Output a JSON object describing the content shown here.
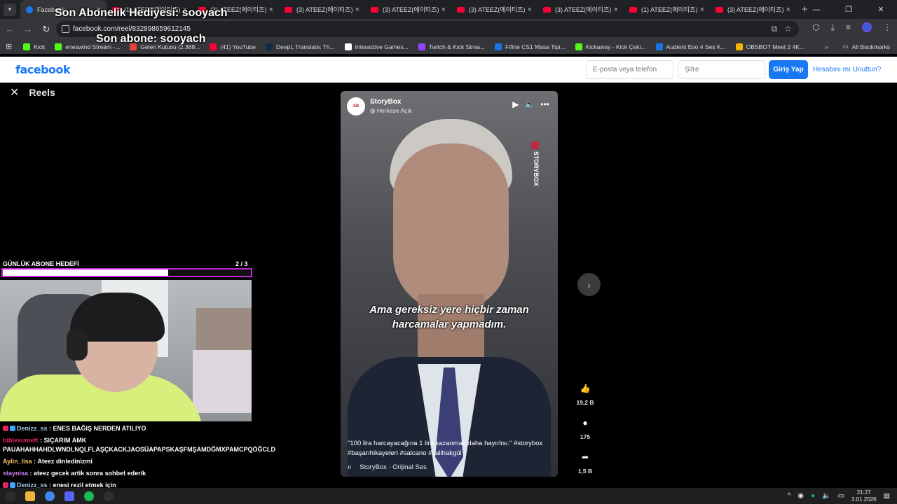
{
  "browser": {
    "tabs": [
      {
        "title": "Facebook",
        "active": true,
        "favicon": "facebook-icon"
      },
      {
        "title": "(1) ATEEZ(에이티즈)",
        "favicon": "youtube-icon"
      },
      {
        "title": "(3) ATEEZ(에이티즈)",
        "favicon": "youtube-icon"
      },
      {
        "title": "(3) ATEEZ(에이티즈)",
        "favicon": "youtube-icon"
      },
      {
        "title": "(3) ATEEZ(에이티즈)",
        "favicon": "youtube-icon"
      },
      {
        "title": "(3) ATEEZ(에이티즈)",
        "favicon": "youtube-icon"
      },
      {
        "title": "(3) ATEEZ(에이티즈)",
        "favicon": "youtube-icon"
      },
      {
        "title": "(1) ATEEZ(에이티즈)",
        "favicon": "youtube-icon"
      },
      {
        "title": "(3) ATEEZ(에이티즈)",
        "favicon": "youtube-icon"
      }
    ],
    "url": "facebook.com/reel/832898659612145",
    "bookmarks": [
      {
        "label": "Kick",
        "color": "#53fc18"
      },
      {
        "label": "eneswind Stream -...",
        "color": "#53fc18"
      },
      {
        "label": "Gelen Kutusu (2.368...",
        "color": "#ea4335"
      },
      {
        "label": "(41) YouTube",
        "color": "#ff0033"
      },
      {
        "label": "DeepL Translate: Th...",
        "color": "#0f2b46"
      },
      {
        "label": "Interactive Games...",
        "color": "#ffffff"
      },
      {
        "label": "Twitch & Kick Strea...",
        "color": "#9146ff"
      },
      {
        "label": "Fifine CS1 Masa Tipi...",
        "color": "#1a73e8"
      },
      {
        "label": "Kickaway - Kick Çeki...",
        "color": "#53fc18"
      },
      {
        "label": "Audient Evo 4 Ses K...",
        "color": "#1a73e8"
      },
      {
        "label": "OBSBOT Meet 2 4K...",
        "color": "#f4b400"
      }
    ],
    "all_bookmarks": "All Bookmarks"
  },
  "facebook": {
    "logo": "facebook",
    "email_placeholder": "E-posta veya telefon",
    "password_placeholder": "Şifre",
    "login_label": "Giriş Yap",
    "forgot_label": "Hesabını mı Unuttun?"
  },
  "reels": {
    "title": "Reels",
    "video": {
      "channel": "StoryBox",
      "privacy": "Herkese Açık",
      "brand_text": "STORYBOX",
      "subtitle": "Ama gereksiz yere hiçbir zaman harcamalar yapmadım.",
      "caption": "\"100 lira harcayacağına 1 lira kazanmak daha hayırlısı.\" #storybox #başarıhikayeleri #salcano  #salihakgül",
      "audio": "StoryBox · Orijinal Ses"
    },
    "actions": {
      "likes": "19,2 B",
      "comments": "175",
      "shares": "1,5 B"
    }
  },
  "stream_overlay": {
    "last_sub_gift": "Son Abonelik Hediyesi: sooyach",
    "last_sub": "Son abone: sooyach",
    "goal_label": "GÜNLÜK ABONE HEDEFİ",
    "goal_count": "2  / 3",
    "goal_progress": 0.667,
    "accent": "#c026d3",
    "chat": [
      {
        "user": "Denizz_ss",
        "user_color": "#a7c7e7",
        "text": ": ENES BAĞIŞ NERDEN ATILIYO"
      },
      {
        "user": "biblesumett",
        "user_color": "#e0245e",
        "text": ": SIÇARIM AMK PAUAHAHHAHDLWNDLNQLFLAŞÇKACKJAOSÜAPAPSKAŞFMŞAMDĞMXPAMCPQÖĞCLD"
      },
      {
        "user": "Aylin_lisa",
        "user_color": "#f3c06b",
        "text": ": Ateez dinledinizmi"
      },
      {
        "user": "staynisa",
        "user_color": "#d17cf2",
        "text": ": ateez gecek artik sonra sohbet ederik"
      },
      {
        "user": "Denizz_ss",
        "user_color": "#a7c7e7",
        "text": ": enesi rezil etmek için"
      }
    ]
  },
  "taskbar": {
    "time": "21:27",
    "date": "3.01.2026"
  }
}
